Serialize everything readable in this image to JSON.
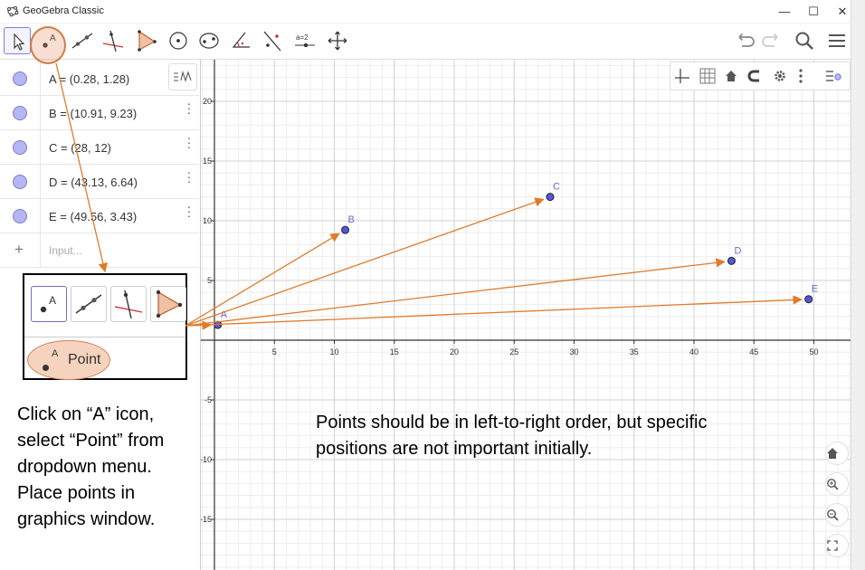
{
  "window": {
    "title": "GeoGebra Classic",
    "minimize": "—",
    "maximize": "☐",
    "close": "✕"
  },
  "algebra": {
    "rows": [
      {
        "label": "A = (0.28, 1.28)"
      },
      {
        "label": "B = (10.91, 9.23)"
      },
      {
        "label": "C = (28, 12)"
      },
      {
        "label": "D = (43.13, 6.64)"
      },
      {
        "label": "E = (49.56, 3.43)"
      }
    ],
    "input_placeholder": "Input...",
    "marble_color": "#b6b6f2"
  },
  "graphics": {
    "x_ticks": [
      5,
      10,
      15,
      20,
      25,
      30,
      35,
      40,
      45,
      50
    ],
    "y_ticks_pos": [
      5,
      10,
      15,
      20
    ],
    "y_ticks_neg": [
      -5,
      -10,
      -15
    ],
    "points": [
      {
        "name": "A",
        "x": 0.28,
        "y": 1.28
      },
      {
        "name": "B",
        "x": 10.91,
        "y": 9.23
      },
      {
        "name": "C",
        "x": 28,
        "y": 12
      },
      {
        "name": "D",
        "x": 43.13,
        "y": 6.64
      },
      {
        "name": "E",
        "x": 49.56,
        "y": 3.43
      }
    ],
    "point_color": "#5555dd",
    "label_color": "#6b6bd0"
  },
  "callout": {
    "menu_item_letter": "A",
    "menu_item_label": "Point"
  },
  "annotation": {
    "accent": "#e07b2a",
    "instruction_left": "Click on “A” icon, select “Point” from dropdown menu. Place points in graphics window.",
    "instruction_right": "Points should be in left-to-right order, but specific positions are not important initially."
  }
}
